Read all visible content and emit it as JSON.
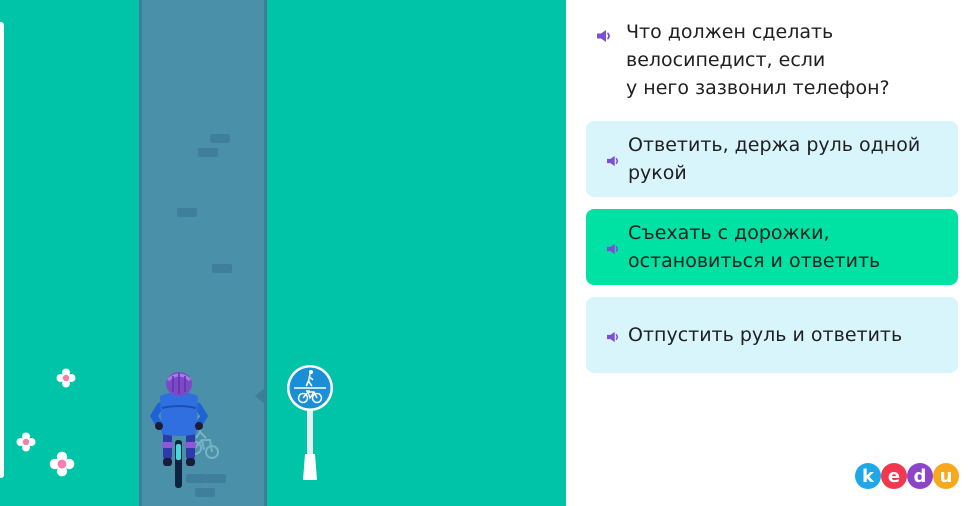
{
  "question": {
    "text": "Что должен сделать\nвелосипедист, если\nу него зазвонил телефон?"
  },
  "answers": [
    {
      "label": "Ответить, держа руль одной рукой",
      "selected": false
    },
    {
      "label": "Съехать с дорожки, остановиться и ответить",
      "selected": true
    },
    {
      "label": "Отпустить руль и ответить",
      "selected": false
    }
  ],
  "logo": {
    "letters": [
      "k",
      "e",
      "d",
      "u"
    ],
    "colors": [
      "#1fa8e8",
      "#f2384e",
      "#8e44c9",
      "#f7a81b"
    ]
  },
  "colors": {
    "grass": "#00c4a7",
    "path": "#4a90a8",
    "answer_default": "#d9f5fc",
    "answer_selected": "#00e2a4",
    "speaker_icon": "#7b4fd6",
    "sign": "#1a8fd6"
  },
  "icons": {
    "speaker": "speaker-icon",
    "sign": "bike-pedestrian-sign-icon",
    "flower": "flower-icon"
  }
}
